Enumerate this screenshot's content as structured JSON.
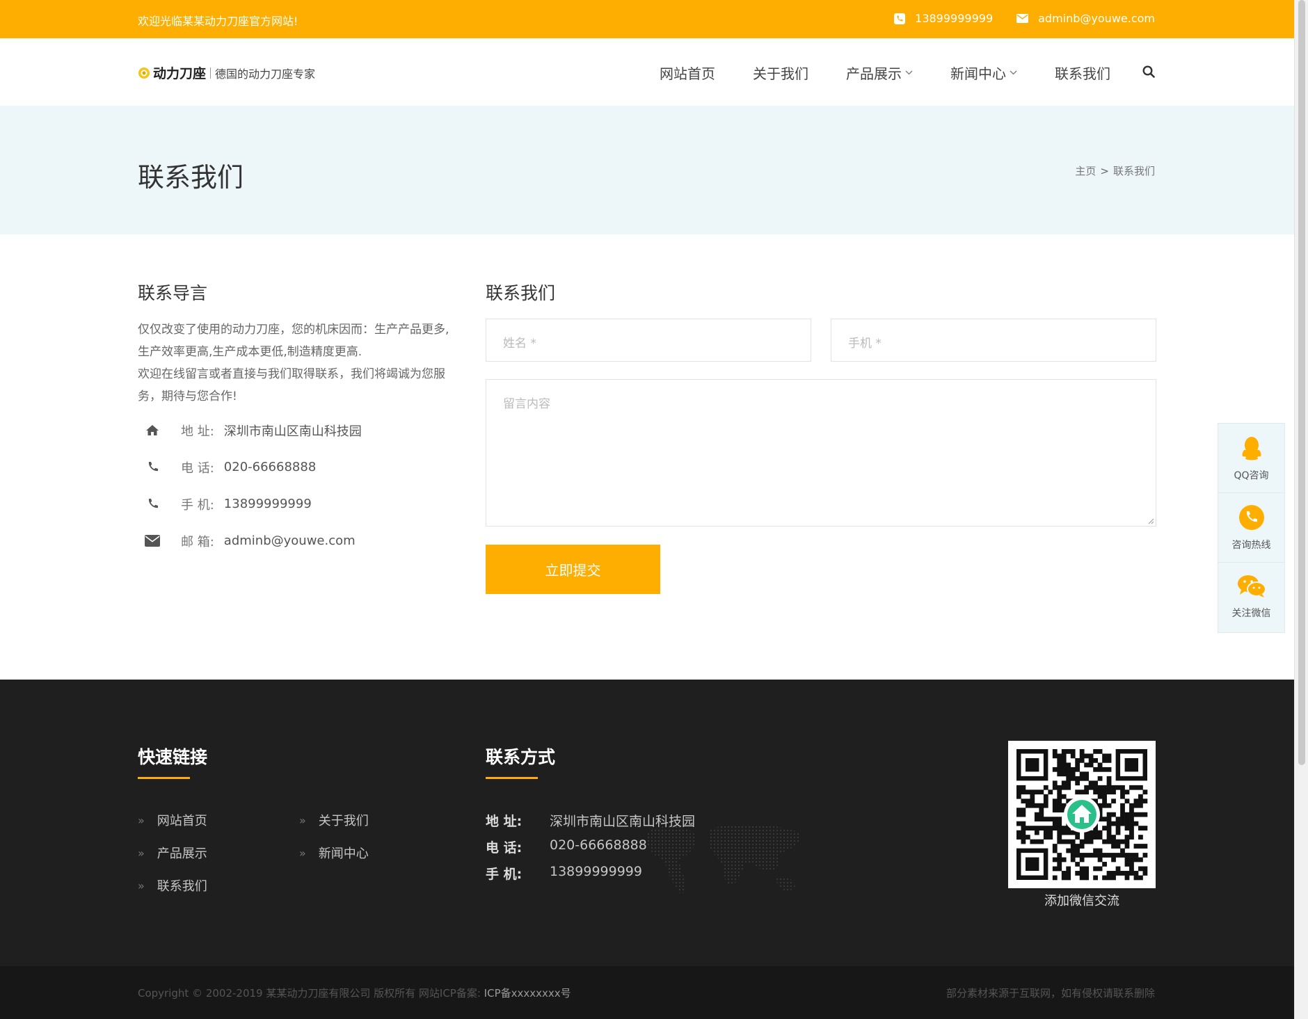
{
  "topbar": {
    "welcome": "欢迎光临某某动力刀座官方网站!",
    "phone": "13899999999",
    "email": "adminb@youwe.com",
    "bg_color": "#fdae01"
  },
  "header": {
    "brand": "动力刀座",
    "slogan": "德国的动力刀座专家",
    "nav": [
      {
        "label": "网站首页"
      },
      {
        "label": "关于我们"
      },
      {
        "label": "产品展示",
        "dropdown": true
      },
      {
        "label": "新闻中心",
        "dropdown": true
      },
      {
        "label": "联系我们"
      }
    ],
    "search_icon": "search-icon"
  },
  "banner": {
    "title": "联系我们",
    "breadcrumb": [
      "主页",
      ">",
      "联系我们"
    ]
  },
  "intro": {
    "heading": "联系导言",
    "paragraph_1": "仅仅改变了使用的动力刀座，您的机床因而：生产产品更多,生产效率更高,生产成本更低,制造精度更高.",
    "paragraph_2": "欢迎在线留言或者直接与我们取得联系，我们将竭诚为您服务，期待与您合作!",
    "rows": [
      {
        "icon": "home-icon",
        "label": "地 址:",
        "value": "深圳市南山区南山科技园"
      },
      {
        "icon": "phone-icon",
        "label": "电 话:",
        "value": "020-66668888"
      },
      {
        "icon": "phone-icon",
        "label": "手 机:",
        "value": "13899999999"
      },
      {
        "icon": "envelope-icon",
        "label": "邮 箱:",
        "value": "adminb@youwe.com"
      }
    ]
  },
  "form": {
    "heading": "联系我们",
    "name_placeholder": "姓名 *",
    "mobile_placeholder": "手机 *",
    "message_placeholder": "留言内容",
    "submit_label": "立即提交"
  },
  "side_float": [
    {
      "icon": "qq-icon",
      "label": "QQ咨询"
    },
    {
      "icon": "phone-circle-icon",
      "label": "咨询热线"
    },
    {
      "icon": "wechat-icon",
      "label": "关注微信"
    }
  ],
  "footer": {
    "links_title": "快速链接",
    "links": [
      "网站首页",
      "关于我们",
      "产品展示",
      "新闻中心",
      "联系我们"
    ],
    "contact_title": "联系方式",
    "contact": [
      {
        "k": "地 址:",
        "v": "深圳市南山区南山科技园"
      },
      {
        "k": "电 话:",
        "v": "020-66668888"
      },
      {
        "k": "手 机:",
        "v": "13899999999"
      }
    ],
    "qr_caption": "添加微信交流"
  },
  "copyright": {
    "left": "Copyright © 2002-2019 某某动力刀座有限公司 版权所有   网站ICP备案: ",
    "icp": "ICP备xxxxxxxx号",
    "right": "部分素材来源于互联网，如有侵权请联系删除"
  }
}
